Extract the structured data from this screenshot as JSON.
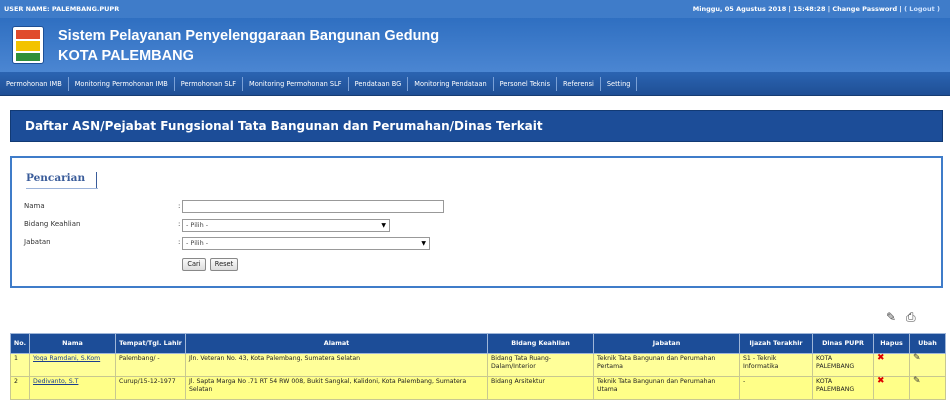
{
  "topbar": {
    "user_label": "USER NAME: PALEMBANG.PUPR",
    "datetime": "Minggu, 05 Agustus 2018 | 15:48:28",
    "change_password": "Change Password",
    "logout": "( Logout )"
  },
  "header": {
    "title": "Sistem Pelayanan Penyelenggaraan Bangunan Gedung",
    "subtitle": "KOTA PALEMBANG"
  },
  "nav": {
    "items": [
      "Permohonan IMB",
      "Monitoring Permohonan IMB",
      "Permohonan SLF",
      "Monitoring Permohonan SLF",
      "Pendataan BG",
      "Monitoring Pendataan",
      "Personel Teknis",
      "Referensi",
      "Setting"
    ]
  },
  "page": {
    "title": "Daftar ASN/Pejabat Fungsional Tata Bangunan dan Perumahan/Dinas Terkait"
  },
  "search": {
    "legend": "Pencarian",
    "fields": {
      "nama_label": "Nama",
      "nama_value": "",
      "bidang_label": "Bidang Keahlian",
      "bidang_value": "- Pilih -",
      "jabatan_label": "Jabatan",
      "jabatan_value": "- Pilih -"
    },
    "colon": ":",
    "cari_label": "Cari",
    "reset_label": "Reset"
  },
  "icons": {
    "export": "check-export-icon",
    "print": "printer-icon",
    "hapus": "delete-x-icon",
    "ubah": "pencil-icon"
  },
  "colors": {
    "header_blue": "#3f7cc9",
    "nav_blue": "#1f4f95",
    "row_yellow": "#ffff99",
    "delete_red": "#d00000"
  },
  "table": {
    "headers": [
      "No.",
      "Nama",
      "Tempat/Tgl. Lahir",
      "Alamat",
      "Bidang Keahlian",
      "Jabatan",
      "Ijazah Terakhir",
      "Dinas PUPR",
      "Hapus",
      "Ubah"
    ],
    "rows": [
      {
        "no": "1",
        "nama": "Yoga Ramdani, S.Kom",
        "ttl": "Palembang/ -",
        "alamat": "Jln. Veteran No. 43, Kota Palembang, Sumatera Selatan",
        "bidang": "Bidang Tata Ruang-Dalam/Interior",
        "jabatan": "Teknik Tata Bangunan dan Perumahan Pertama",
        "ijazah": "S1 - Teknik Informatika",
        "dinas": "KOTA PALEMBANG"
      },
      {
        "no": "2",
        "nama": "Dedivanto, S.T",
        "ttl": "Curup/15-12-1977",
        "alamat": "Jl. Sapta Marga No .71 RT 54 RW 008, Bukit Sangkal, Kalidoni, Kota Palembang, Sumatera Selatan",
        "bidang": "Bidang Arsitektur",
        "jabatan": "Teknik Tata Bangunan dan Perumahan Utama",
        "ijazah": "-",
        "dinas": "KOTA PALEMBANG"
      }
    ]
  }
}
